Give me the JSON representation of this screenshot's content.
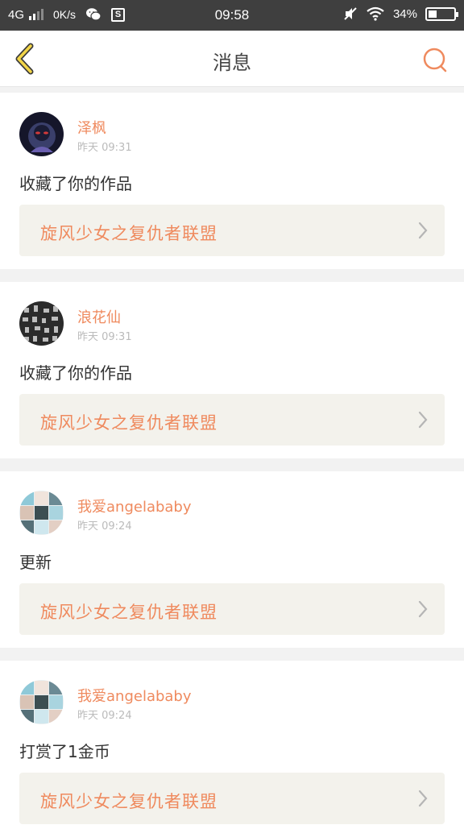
{
  "status_bar": {
    "network": "4G",
    "speed": "0K/s",
    "time": "09:58",
    "battery": "34%",
    "battery_level": 0.34,
    "icons": [
      "signal-icon",
      "wechat-icon",
      "s-app-icon",
      "mute-icon",
      "wifi-icon",
      "battery-icon"
    ]
  },
  "header": {
    "title": "消息",
    "back_icon": "chevron-left-icon",
    "search_icon": "search-icon"
  },
  "colors": {
    "accent": "#ef8a5e",
    "back_arrow": "#f2d548",
    "card_link_bg": "#f3f2ec",
    "page_bg": "#f2f2f2"
  },
  "messages": [
    {
      "username": "泽枫",
      "time": "昨天 09:31",
      "action": "收藏了你的作品",
      "work_title": "旋风少女之复仇者联盟",
      "avatar": "dark"
    },
    {
      "username": "浪花仙",
      "time": "昨天 09:31",
      "action": "收藏了你的作品",
      "work_title": "旋风少女之复仇者联盟",
      "avatar": "pattern"
    },
    {
      "username": "我爱angelababy",
      "time": "昨天 09:24",
      "action": "更新",
      "work_title": "旋风少女之复仇者联盟",
      "avatar": "grid"
    },
    {
      "username": "我爱angelababy",
      "time": "昨天 09:24",
      "action": "打赏了1金币",
      "work_title": "旋风少女之复仇者联盟",
      "avatar": "grid"
    }
  ]
}
